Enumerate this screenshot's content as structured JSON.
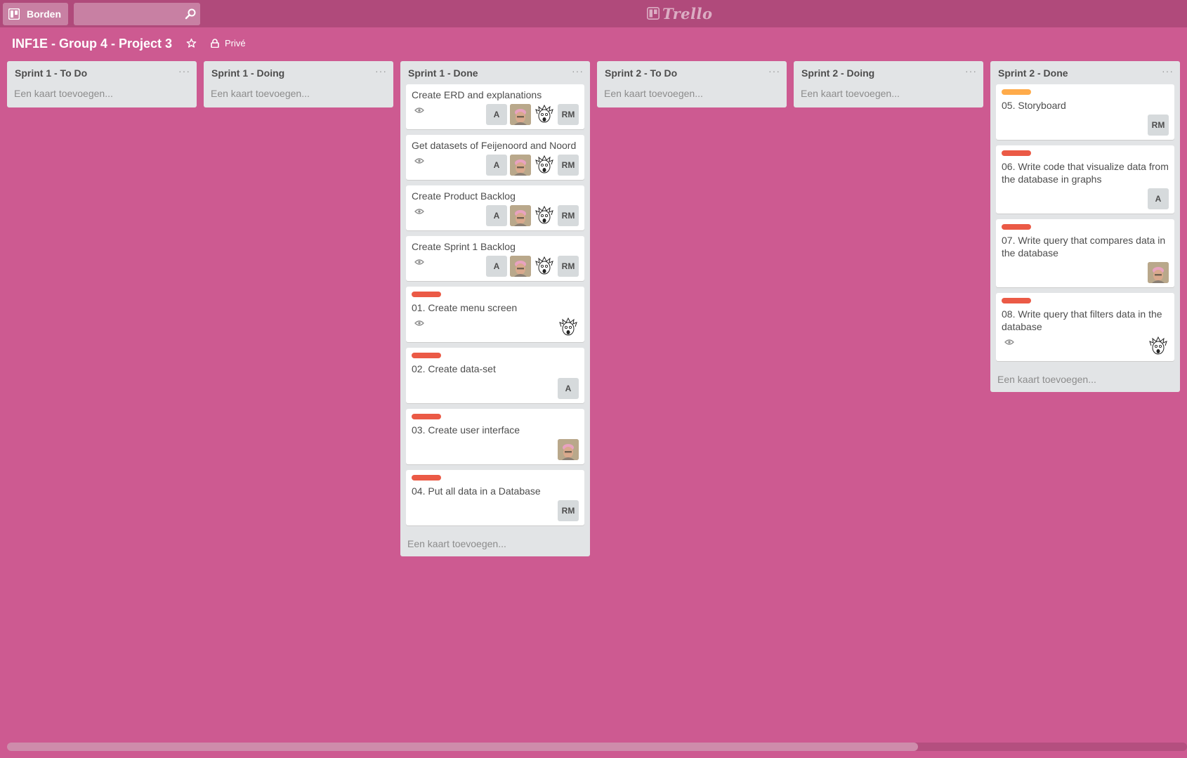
{
  "header": {
    "boards_label": "Borden",
    "search_value": "",
    "search_placeholder": "",
    "logo_text": "Trello"
  },
  "board": {
    "title": "INF1E - Group 4 - Project 3",
    "privacy": "Privé"
  },
  "colors": {
    "background": "#cd5a91",
    "header": "#b04a7b",
    "label_red": "#eb5a46",
    "label_orange": "#ffab4a"
  },
  "add_card_label": "Een kaart toevoegen...",
  "lists": [
    {
      "title": "Sprint 1 - To Do",
      "add_card": "Een kaart toevoegen..."
    },
    {
      "title": "Sprint 1 - Doing",
      "add_card": "Een kaart toevoegen..."
    },
    {
      "title": "Sprint 1 - Done",
      "add_card": "Een kaart toevoegen...",
      "cards": [
        {
          "title": "Create ERD and explanations",
          "label": null,
          "watched": true,
          "members": [
            "A",
            "photo",
            "sketch",
            "RM"
          ]
        },
        {
          "title": "Get datasets of Feijenoord and Noord",
          "label": null,
          "watched": true,
          "members": [
            "A",
            "photo",
            "sketch",
            "RM"
          ]
        },
        {
          "title": "Create Product Backlog",
          "label": null,
          "watched": true,
          "members": [
            "A",
            "photo",
            "sketch",
            "RM"
          ]
        },
        {
          "title": "Create Sprint 1 Backlog",
          "label": null,
          "watched": true,
          "members": [
            "A",
            "photo",
            "sketch",
            "RM"
          ]
        },
        {
          "title": "01. Create menu screen",
          "label": "#eb5a46",
          "watched": true,
          "members": [
            "sketch"
          ]
        },
        {
          "title": "02. Create data-set",
          "label": "#eb5a46",
          "watched": false,
          "members": [
            "A"
          ]
        },
        {
          "title": "03. Create user interface",
          "label": "#eb5a46",
          "watched": false,
          "members": [
            "photo"
          ]
        },
        {
          "title": "04. Put all data in a Database",
          "label": "#eb5a46",
          "watched": false,
          "members": [
            "RM"
          ]
        }
      ]
    },
    {
      "title": "Sprint 2 - To Do",
      "add_card": "Een kaart toevoegen..."
    },
    {
      "title": "Sprint 2 - Doing",
      "add_card": "Een kaart toevoegen..."
    },
    {
      "title": "Sprint 2 - Done",
      "add_card": "Een kaart toevoegen...",
      "cards": [
        {
          "title": "05. Storyboard",
          "label": "#ffab4a",
          "watched": false,
          "members": [
            "RM"
          ]
        },
        {
          "title": "06. Write code that visualize data from the database in graphs",
          "label": "#eb5a46",
          "watched": false,
          "members": [
            "A"
          ]
        },
        {
          "title": "07. Write query that compares data in the database",
          "label": "#eb5a46",
          "watched": false,
          "members": [
            "photo"
          ]
        },
        {
          "title": "08. Write query that filters data in the database",
          "label": "#eb5a46",
          "watched": true,
          "members": [
            "sketch"
          ]
        }
      ]
    }
  ]
}
